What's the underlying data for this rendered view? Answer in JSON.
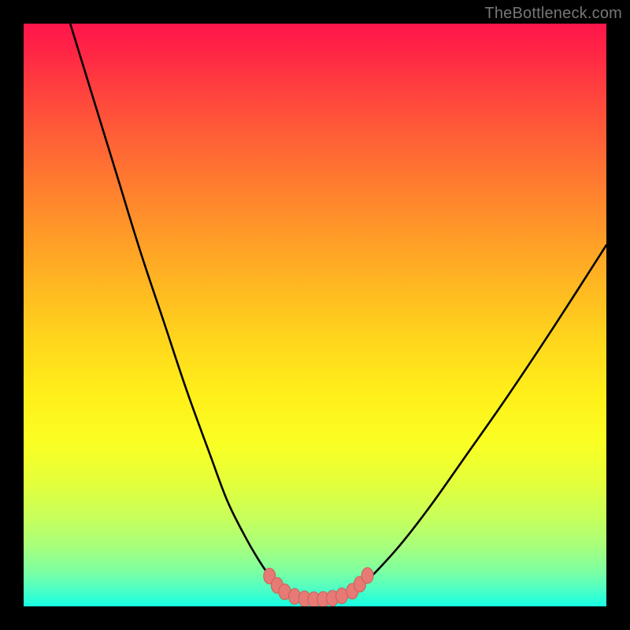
{
  "watermark": "TheBottleneck.com",
  "colors": {
    "frame": "#000000",
    "curve": "#000000",
    "marker_fill": "#e77a75",
    "marker_stroke": "#cc5e58"
  },
  "chart_data": {
    "type": "line",
    "title": "",
    "xlabel": "",
    "ylabel": "",
    "xlim": [
      0,
      100
    ],
    "ylim": [
      0,
      100
    ],
    "grid": false,
    "series": [
      {
        "name": "left-branch",
        "x": [
          8,
          12,
          16,
          20,
          24,
          28,
          32,
          35,
          38,
          40,
          42,
          44,
          45.5
        ],
        "y": [
          100,
          87,
          74,
          61,
          49,
          37,
          26,
          18,
          12,
          8.5,
          5.5,
          3.2,
          2
        ]
      },
      {
        "name": "valley-floor",
        "x": [
          45.5,
          47,
          48.5,
          50,
          51.5,
          53,
          54.5,
          55.5
        ],
        "y": [
          2,
          1.4,
          1.15,
          1.1,
          1.15,
          1.35,
          1.7,
          2
        ]
      },
      {
        "name": "right-branch",
        "x": [
          55.5,
          58,
          61,
          65,
          70,
          76,
          83,
          91,
          100
        ],
        "y": [
          2,
          3.6,
          6.5,
          11,
          17.5,
          26,
          36,
          48,
          62
        ]
      }
    ],
    "markers": {
      "name": "valley-points",
      "x": [
        42.2,
        43.5,
        44.8,
        46.5,
        48.2,
        49.8,
        51.4,
        53,
        54.6,
        56.4,
        57.7,
        59
      ],
      "y": [
        5.2,
        3.6,
        2.5,
        1.7,
        1.3,
        1.15,
        1.2,
        1.4,
        1.8,
        2.6,
        3.8,
        5.3
      ]
    },
    "background_gradient_stops": [
      {
        "pos": 0.0,
        "color": "#ff164b"
      },
      {
        "pos": 0.3,
        "color": "#ff8a2c"
      },
      {
        "pos": 0.6,
        "color": "#ffe61b"
      },
      {
        "pos": 0.82,
        "color": "#d7ff45"
      },
      {
        "pos": 0.96,
        "color": "#58ffbc"
      },
      {
        "pos": 1.0,
        "color": "#16ffe4"
      }
    ]
  }
}
